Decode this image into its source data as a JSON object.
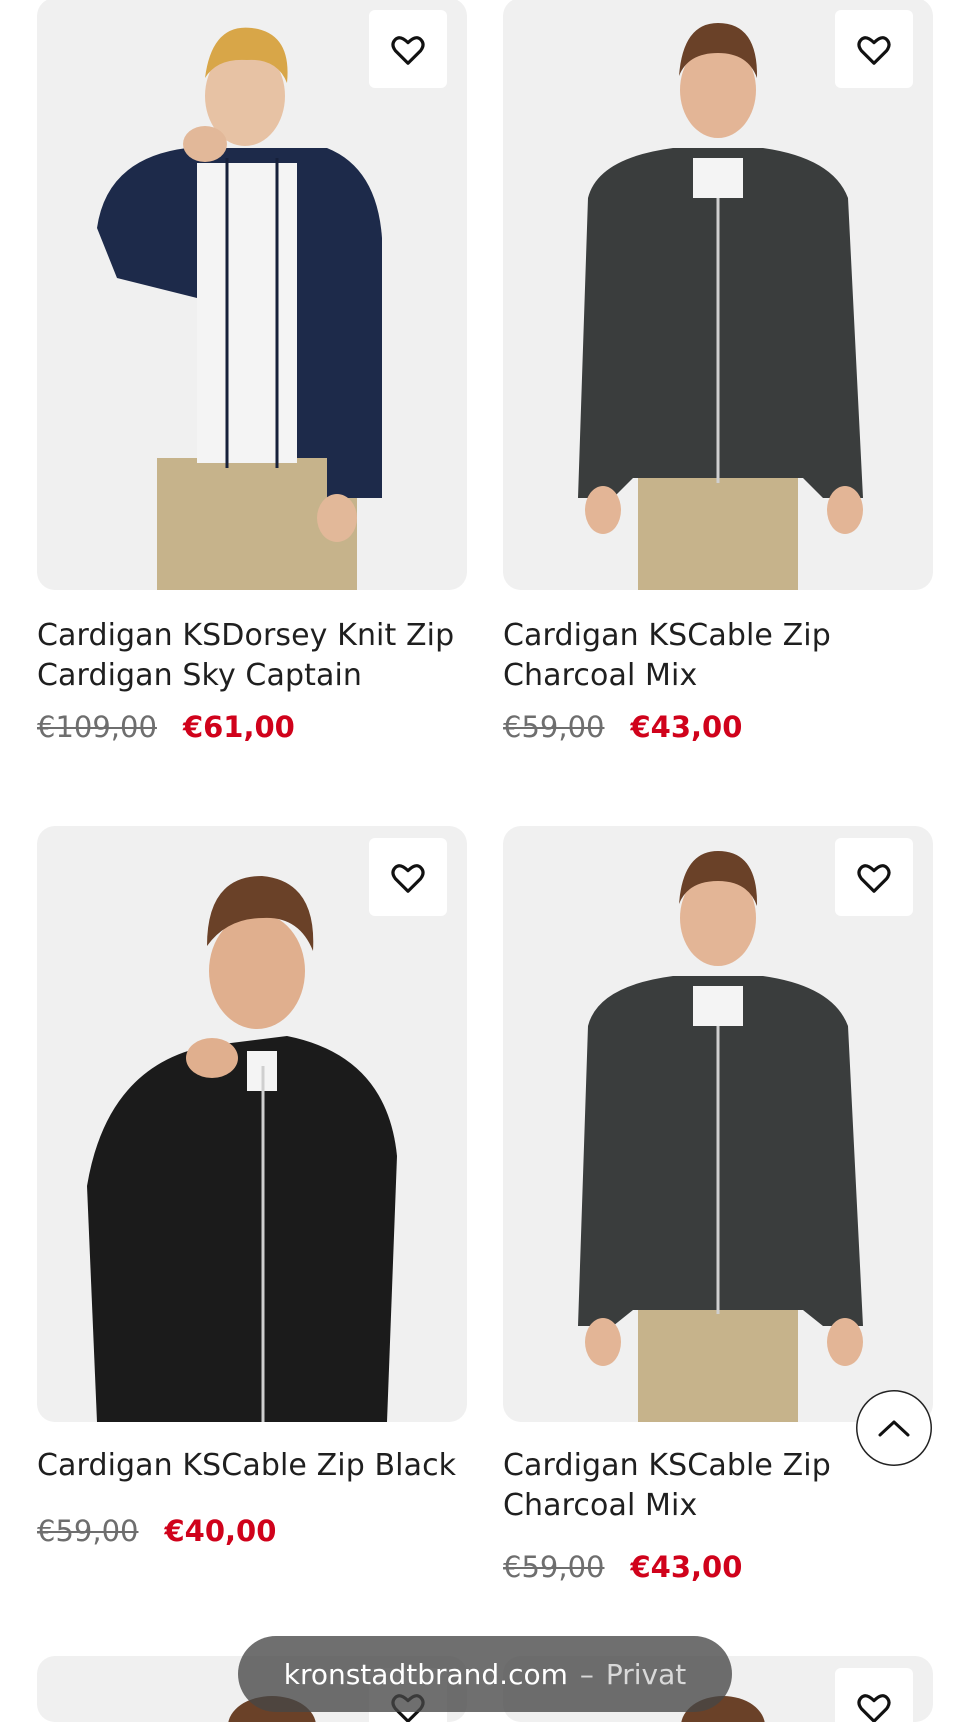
{
  "products": [
    {
      "title": "Cardigan KSDorsey Knit Zip Cardigan Sky Captain",
      "old_price": "€109,00",
      "new_price": "€61,00",
      "jacket_color": "#1d2a4a"
    },
    {
      "title": "Cardigan KSCable Zip Charcoal Mix",
      "old_price": "€59,00",
      "new_price": "€43,00",
      "jacket_color": "#3a3d3d"
    },
    {
      "title": "Cardigan KSCable Zip Black",
      "old_price": "€59,00",
      "new_price": "€40,00",
      "jacket_color": "#1b1b1b"
    },
    {
      "title": "Cardigan KSCable Zip Charcoal Mix",
      "old_price": "€59,00",
      "new_price": "€43,00",
      "jacket_color": "#3a3d3d"
    }
  ],
  "favorite_icon": "heart-outline-icon",
  "scroll_top_icon": "chevron-up-icon",
  "url_bar": {
    "domain": "kronstadtbrand.com",
    "separator": "–",
    "mode": "Privat"
  },
  "colors": {
    "sale_price": "#d0021b",
    "card_bg": "#f0f0f0"
  }
}
